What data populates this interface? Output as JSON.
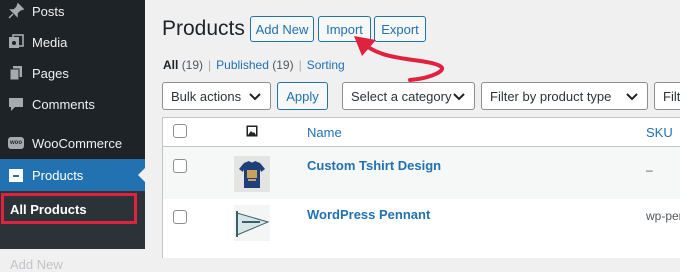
{
  "sidebar": {
    "items": [
      {
        "label": "Posts",
        "icon": "pin-icon"
      },
      {
        "label": "Media",
        "icon": "media-icon"
      },
      {
        "label": "Pages",
        "icon": "pages-icon"
      },
      {
        "label": "Comments",
        "icon": "comment-icon"
      },
      {
        "label": "WooCommerce",
        "icon": "woocommerce-icon",
        "badge": "woo"
      },
      {
        "label": "Products",
        "icon": "products-icon"
      }
    ],
    "submenu": [
      "All Products",
      "Add New"
    ]
  },
  "main": {
    "title": "Products",
    "buttons": {
      "add_new": "Add New",
      "import": "Import",
      "export": "Export"
    },
    "filters": {
      "all": "All",
      "all_count": "(19)",
      "published": "Published",
      "published_count": "(19)",
      "sorting": "Sorting"
    },
    "tablenav": {
      "bulk_actions": "Bulk actions",
      "apply": "Apply",
      "category": "Select a category",
      "product_type": "Filter by product type",
      "stock_partial": "Filt"
    },
    "table": {
      "headers": {
        "name": "Name",
        "sku": "SKU"
      },
      "rows": [
        {
          "name": "Custom Tshirt Design",
          "sku": "–"
        },
        {
          "name": "WordPress Pennant",
          "sku": "wp-pen"
        }
      ]
    }
  },
  "colors": {
    "sidebar_bg": "#1d2327",
    "accent": "#2271b1",
    "highlight": "#e0223f"
  }
}
